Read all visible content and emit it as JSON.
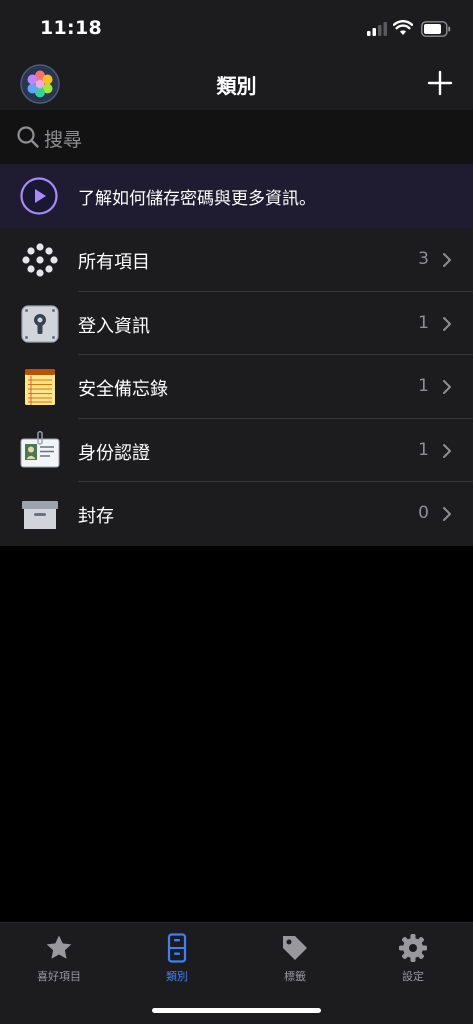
{
  "status_bar": {
    "time": "11:18"
  },
  "nav": {
    "title": "類別"
  },
  "search": {
    "placeholder": "搜尋"
  },
  "banner": {
    "text": "了解如何儲存密碼與更多資訊。"
  },
  "categories": [
    {
      "label": "所有項目",
      "count": "3",
      "icon": "all-items-icon"
    },
    {
      "label": "登入資訊",
      "count": "1",
      "icon": "login-vault-icon"
    },
    {
      "label": "安全備忘錄",
      "count": "1",
      "icon": "secure-note-icon"
    },
    {
      "label": "身份認證",
      "count": "1",
      "icon": "identity-card-icon"
    },
    {
      "label": "封存",
      "count": "0",
      "icon": "archive-box-icon"
    }
  ],
  "tabs": [
    {
      "label": "喜好項目",
      "icon": "star-icon"
    },
    {
      "label": "類別",
      "icon": "file-cabinet-icon",
      "active": true
    },
    {
      "label": "標籤",
      "icon": "tag-icon"
    },
    {
      "label": "設定",
      "icon": "gear-icon"
    }
  ],
  "colors": {
    "accent": "#3b82f6",
    "banner_bg": "#1f1c31",
    "play_purple": "#a78bfa"
  }
}
